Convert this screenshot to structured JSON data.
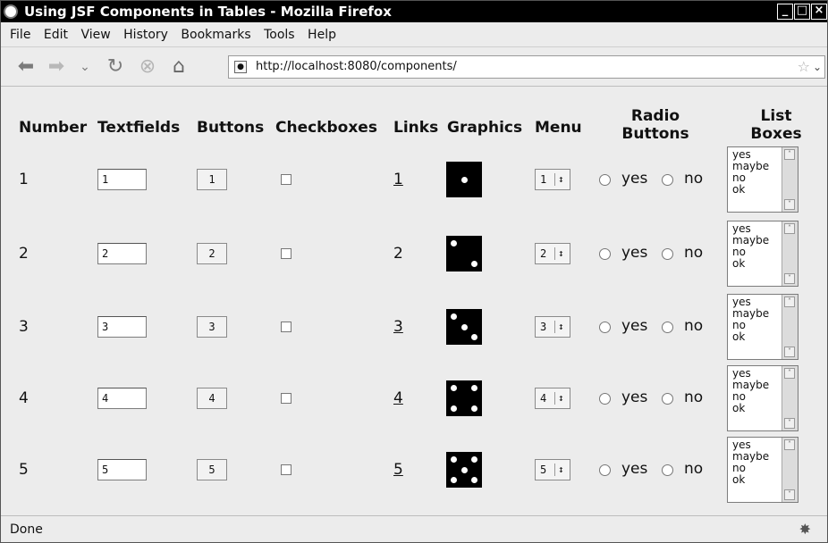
{
  "window": {
    "title": "Using JSF Components in Tables - Mozilla Firefox"
  },
  "menu": [
    "File",
    "Edit",
    "View",
    "History",
    "Bookmarks",
    "Tools",
    "Help"
  ],
  "nav": {
    "url": "http://localhost:8080/components/"
  },
  "table": {
    "headers": [
      "Number",
      "Textfields",
      "Buttons",
      "Checkboxes",
      "Links",
      "Graphics",
      "Menu",
      "Radio Buttons",
      "List Boxes"
    ],
    "rows": [
      {
        "number": "1",
        "textfield": "1",
        "button": "1",
        "link": "1",
        "menu": "1",
        "yes": "yes",
        "no": "no"
      },
      {
        "number": "2",
        "textfield": "2",
        "button": "2",
        "link": "2",
        "menu": "2",
        "yes": "yes",
        "no": "no"
      },
      {
        "number": "3",
        "textfield": "3",
        "button": "3",
        "link": "3",
        "menu": "3",
        "yes": "yes",
        "no": "no"
      },
      {
        "number": "4",
        "textfield": "4",
        "button": "4",
        "link": "4",
        "menu": "4",
        "yes": "yes",
        "no": "no"
      },
      {
        "number": "5",
        "textfield": "5",
        "button": "5",
        "link": "5",
        "menu": "5",
        "yes": "yes",
        "no": "no"
      }
    ],
    "listbox_options": [
      "yes",
      "maybe",
      "no",
      "ok"
    ]
  },
  "status": {
    "text": "Done"
  }
}
